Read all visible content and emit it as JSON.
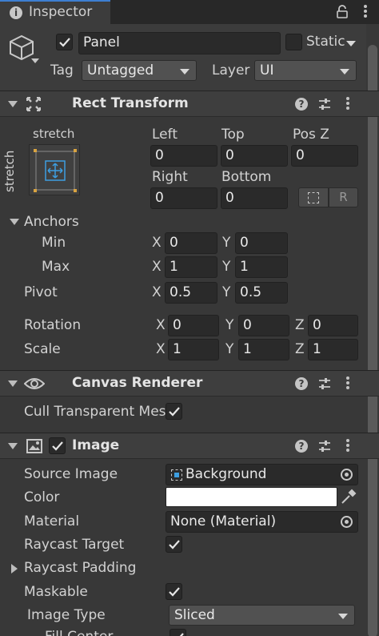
{
  "tab": {
    "title": "Inspector"
  },
  "gameobject": {
    "name": "Panel",
    "active": true,
    "static_label": "Static",
    "static_checked": false,
    "tag_label": "Tag",
    "tag_value": "Untagged",
    "layer_label": "Layer",
    "layer_value": "UI"
  },
  "rect_transform": {
    "title": "Rect Transform",
    "anchor_preset_top": "stretch",
    "anchor_preset_side": "stretch",
    "col_labels_1": [
      "Left",
      "Top",
      "Pos Z"
    ],
    "col_values_1": [
      "0",
      "0",
      "0"
    ],
    "col_labels_2": [
      "Right",
      "Bottom"
    ],
    "col_values_2": [
      "0",
      "0"
    ],
    "raw_button": "R",
    "anchors_label": "Anchors",
    "min_label": "Min",
    "min_x": "0",
    "min_y": "0",
    "max_label": "Max",
    "max_x": "1",
    "max_y": "1",
    "pivot_label": "Pivot",
    "pivot_x": "0.5",
    "pivot_y": "0.5",
    "rotation_label": "Rotation",
    "rotation": [
      "0",
      "0",
      "0"
    ],
    "scale_label": "Scale",
    "scale": [
      "1",
      "1",
      "1"
    ],
    "x": "X",
    "y": "Y",
    "z": "Z"
  },
  "canvas_renderer": {
    "title": "Canvas Renderer",
    "cull_label": "Cull Transparent Mes",
    "cull_checked": true
  },
  "image": {
    "title": "Image",
    "enabled": true,
    "source_image_label": "Source Image",
    "source_image_value": "Background",
    "color_label": "Color",
    "color_value": "#ffffff",
    "material_label": "Material",
    "material_value": "None (Material)",
    "raycast_target_label": "Raycast Target",
    "raycast_target_checked": true,
    "raycast_padding_label": "Raycast Padding",
    "maskable_label": "Maskable",
    "maskable_checked": true,
    "image_type_label": "Image Type",
    "image_type_value": "Sliced",
    "fill_center_label": "Fill Center"
  },
  "colors": {
    "bg": "#383838",
    "header_bg": "#3e3e3e",
    "field_bg": "#2a2a2a",
    "accent_blue": "#3d9ee0"
  }
}
